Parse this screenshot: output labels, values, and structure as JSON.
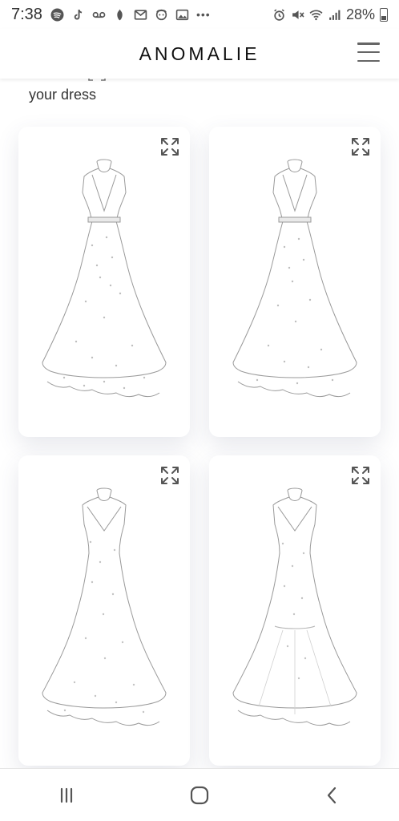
{
  "status_bar": {
    "time": "7:38",
    "left_icons": [
      "spotify-icon",
      "tiktok-icon",
      "voicemail-icon",
      "notification-icon",
      "gmail-icon",
      "bitmoji-icon",
      "gallery-icon",
      "more-icon"
    ],
    "more": "•••",
    "battery": "28%"
  },
  "header": {
    "brand": "ANOMALIE",
    "menu_icon": "hamburger-menu-icon"
  },
  "content": {
    "subtitle": "your dress",
    "cards": [
      {
        "expand_icon": "expand-icon",
        "style": "plunge-neckline-belted-mermaid"
      },
      {
        "expand_icon": "expand-icon",
        "style": "plunge-neckline-belted-mermaid"
      },
      {
        "expand_icon": "expand-icon",
        "style": "v-neck-lace-mermaid"
      },
      {
        "expand_icon": "expand-icon",
        "style": "v-neck-lace-mermaid-tulle-skirt"
      }
    ]
  },
  "nav": {
    "recents_icon": "recents-icon",
    "home_icon": "home-icon",
    "back_icon": "back-icon"
  },
  "colors": {
    "background": "#f4f5f8",
    "header": "#ffffff",
    "brand_text": "#111111",
    "card": "#ffffff",
    "icon_gray": "#555555"
  }
}
